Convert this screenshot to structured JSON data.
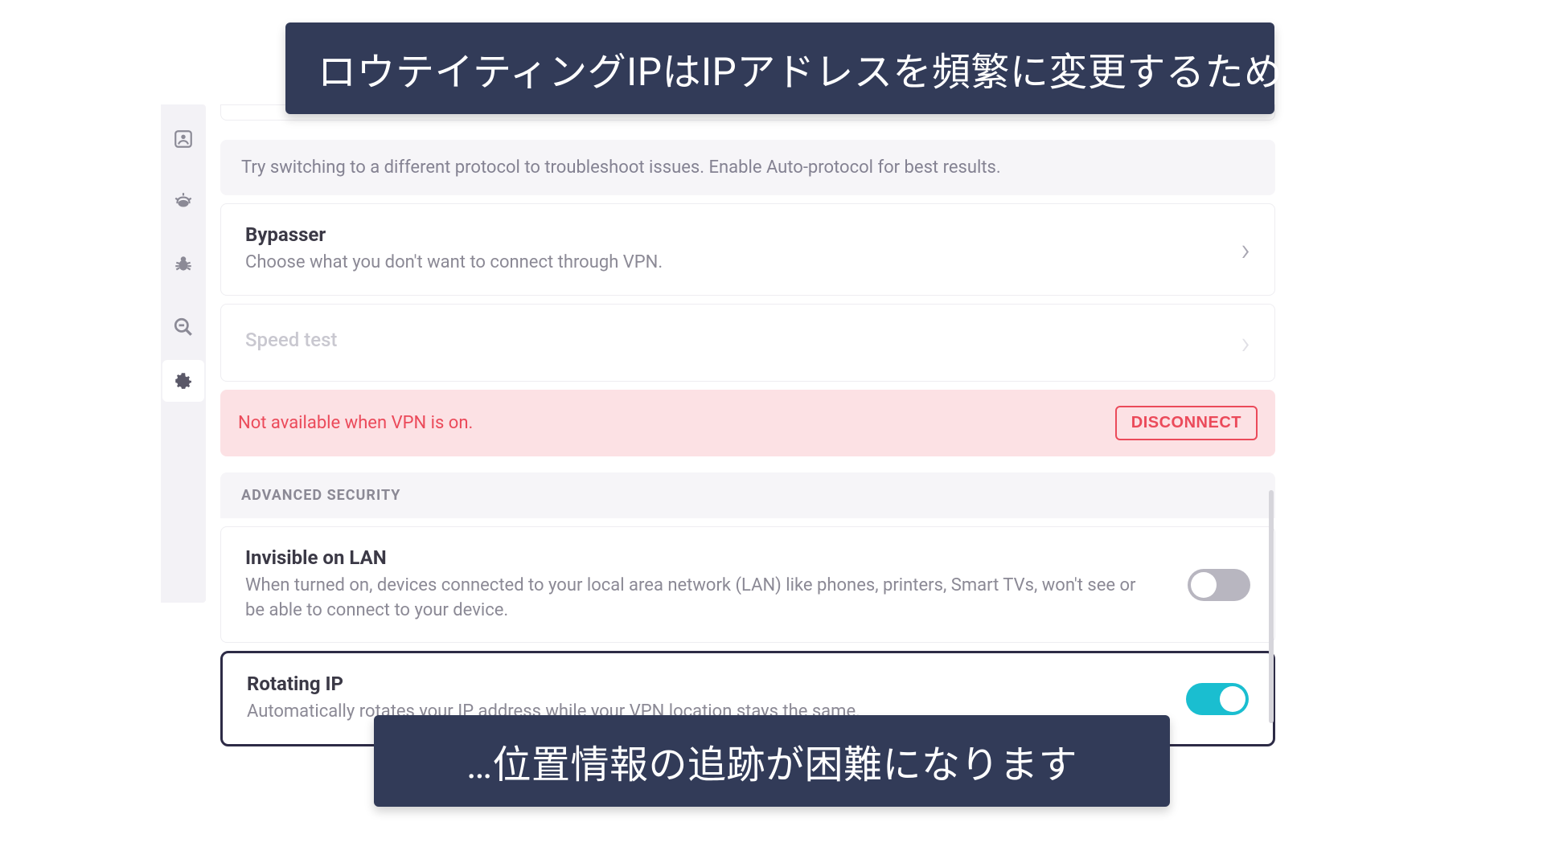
{
  "banners": {
    "top": "ロウテイティングIPはIPアドレスを頻繁に変更するため…",
    "bottom": "…位置情報の追跡が困難になります"
  },
  "sidebar": {
    "items": [
      {
        "name": "account-icon"
      },
      {
        "name": "alert-icon"
      },
      {
        "name": "bug-icon"
      },
      {
        "name": "search-minus-icon"
      },
      {
        "name": "gear-icon"
      }
    ]
  },
  "tip": {
    "text": "Try switching to a different protocol to troubleshoot issues. Enable Auto-protocol for best results."
  },
  "bypasser": {
    "title": "Bypasser",
    "desc": "Choose what you don't want to connect through VPN."
  },
  "speedtest": {
    "title": "Speed test"
  },
  "alert": {
    "text": "Not available when VPN is on.",
    "button": "DISCONNECT"
  },
  "advanced": {
    "header": "ADVANCED SECURITY",
    "invisible": {
      "title": "Invisible on LAN",
      "desc": "When turned on, devices connected to your local area network (LAN) like phones, printers, Smart TVs, won't see or be able to connect to your device.",
      "enabled": false
    },
    "rotating": {
      "title": "Rotating IP",
      "desc": "Automatically rotates your IP address while your VPN location stays the same.",
      "enabled": true
    }
  }
}
